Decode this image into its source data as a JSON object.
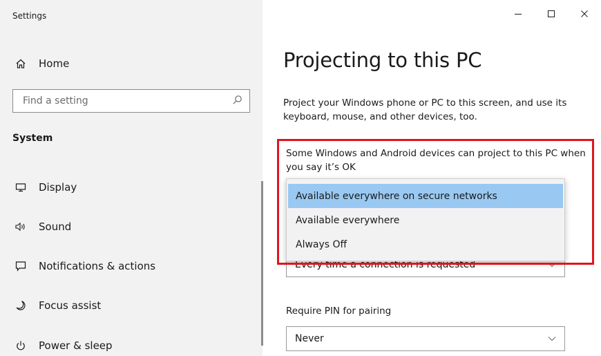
{
  "window": {
    "title": "Settings",
    "controls": {
      "minimize_icon": "minimize-icon",
      "maximize_icon": "maximize-icon",
      "close_icon": "close-icon"
    }
  },
  "sidebar": {
    "home_label": "Home",
    "search": {
      "placeholder": "Find a setting",
      "icon": "search-icon"
    },
    "section_label": "System",
    "items": [
      {
        "label": "Display",
        "icon": "monitor-icon"
      },
      {
        "label": "Sound",
        "icon": "speaker-icon"
      },
      {
        "label": "Notifications & actions",
        "icon": "notification-icon"
      },
      {
        "label": "Focus assist",
        "icon": "moon-icon"
      },
      {
        "label": "Power & sleep",
        "icon": "power-icon"
      }
    ]
  },
  "main": {
    "title": "Projecting to this PC",
    "description": "Project your Windows phone or PC to this screen, and use its keyboard, mouse, and other devices, too.",
    "projection": {
      "question": "Some Windows and Android devices can project to this PC when you say it’s OK",
      "options": [
        "Available everywhere on secure networks",
        "Available everywhere",
        "Always Off"
      ],
      "selected_index": 0
    },
    "ask_select": {
      "value": "Every time a connection is requested"
    },
    "pin": {
      "label": "Require PIN for pairing",
      "value": "Never"
    }
  },
  "colors": {
    "sidebar_bg": "#f2f2f2",
    "selected_option": "#99c9f2",
    "highlight_border": "#e0141f"
  }
}
